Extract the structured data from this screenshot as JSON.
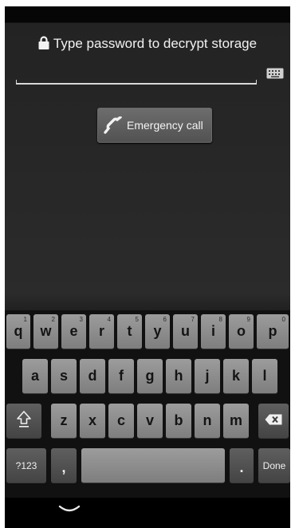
{
  "lockscreen": {
    "prompt": "Type password to decrypt storage",
    "password_value": "",
    "emergency_label": "Emergency call"
  },
  "keyboard": {
    "row1": [
      {
        "letter": "q",
        "hint": "1"
      },
      {
        "letter": "w",
        "hint": "2"
      },
      {
        "letter": "e",
        "hint": "3"
      },
      {
        "letter": "r",
        "hint": "4"
      },
      {
        "letter": "t",
        "hint": "5"
      },
      {
        "letter": "y",
        "hint": "6"
      },
      {
        "letter": "u",
        "hint": "7"
      },
      {
        "letter": "i",
        "hint": "8"
      },
      {
        "letter": "o",
        "hint": "9"
      },
      {
        "letter": "p",
        "hint": "0"
      }
    ],
    "row2": [
      "a",
      "s",
      "d",
      "f",
      "g",
      "h",
      "j",
      "k",
      "l"
    ],
    "row3": [
      "z",
      "x",
      "c",
      "v",
      "b",
      "n",
      "m"
    ],
    "symbols_label": "?123",
    "comma_label": ",",
    "period_label": ".",
    "done_label": "Done",
    "shift_icon": "shift-arrow-icon",
    "delete_icon": "backspace-icon"
  },
  "navbar": {
    "back_icon": "chevron-down-icon"
  },
  "colors": {
    "key_light": "#8f8f8f",
    "key_dark": "#545454",
    "text_light": "#f2f2f2",
    "background": "#262626"
  }
}
